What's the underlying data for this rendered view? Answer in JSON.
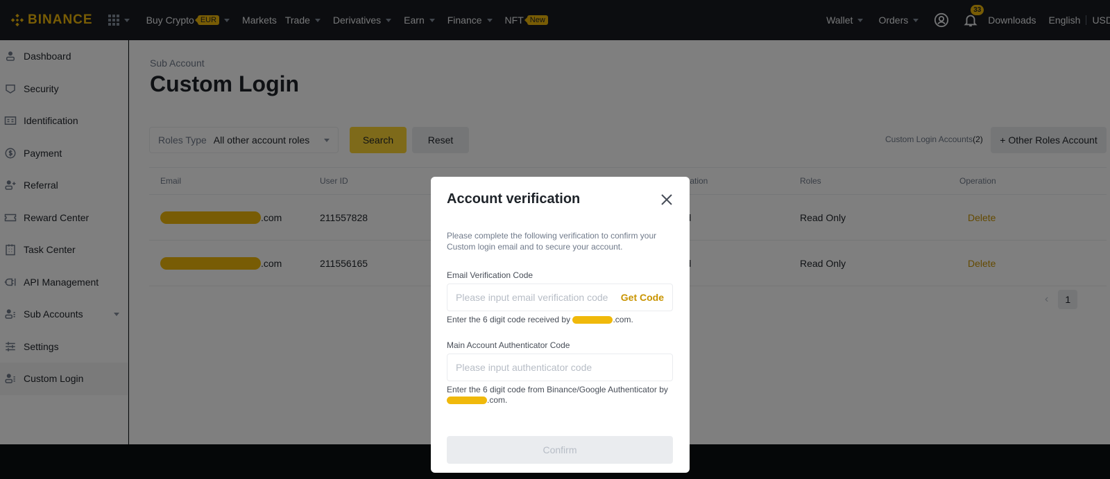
{
  "header": {
    "brand": "BINANCE",
    "nav": [
      {
        "label": "Buy Crypto",
        "badge": "EUR",
        "dropdown": true
      },
      {
        "label": "Markets",
        "dropdown": false
      },
      {
        "label": "Trade",
        "dropdown": true
      },
      {
        "label": "Derivatives",
        "dropdown": true
      },
      {
        "label": "Earn",
        "dropdown": true
      },
      {
        "label": "Finance",
        "dropdown": true
      },
      {
        "label": "NFT",
        "badge": "New",
        "dropdown": false
      }
    ],
    "right": {
      "wallet": "Wallet",
      "orders": "Orders",
      "notifications_count": "33",
      "downloads": "Downloads",
      "language": "English",
      "currency": "USD"
    }
  },
  "sidebar": {
    "items": [
      {
        "label": "Dashboard",
        "icon": "user-icon"
      },
      {
        "label": "Security",
        "icon": "shield-icon"
      },
      {
        "label": "Identification",
        "icon": "id-card-icon"
      },
      {
        "label": "Payment",
        "icon": "dollar-circle-icon"
      },
      {
        "label": "Referral",
        "icon": "user-plus-icon"
      },
      {
        "label": "Reward Center",
        "icon": "ticket-icon"
      },
      {
        "label": "Task Center",
        "icon": "clipboard-icon"
      },
      {
        "label": "API Management",
        "icon": "plug-icon"
      },
      {
        "label": "Sub Accounts",
        "icon": "user-list-icon",
        "dropdown": true
      },
      {
        "label": "Settings",
        "icon": "sliders-icon"
      },
      {
        "label": "Custom Login",
        "icon": "user-list-icon",
        "active": true
      }
    ]
  },
  "main": {
    "breadcrumb": "Sub Account",
    "title": "Custom Login",
    "filter": {
      "label": "Roles Type",
      "value": "All other account roles"
    },
    "search_label": "Search",
    "reset_label": "Reset",
    "accounts_count_label": "Custom Login Accounts",
    "accounts_count": "(2)",
    "other_roles_label": "+ Other Roles Account",
    "table": {
      "columns": [
        "Email",
        "User ID",
        "Verification",
        "Roles",
        "Operation"
      ],
      "columns_visible": {
        "verification": "erification"
      },
      "rows": [
        {
          "email_suffix": ".com",
          "user_id": "211557828",
          "verification": "eted",
          "roles": "Read Only",
          "operation": "Delete"
        },
        {
          "email_suffix": ".com",
          "user_id": "211556165",
          "verification": "eted",
          "roles": "Read Only",
          "operation": "Delete"
        }
      ]
    },
    "pagination": {
      "current_page": "1"
    }
  },
  "modal": {
    "title": "Account verification",
    "description": "Please complete the following verification to confirm your Custom login email and to secure your account.",
    "email_code": {
      "label": "Email Verification Code",
      "placeholder": "Please input email verification code",
      "value": "",
      "get_code_label": "Get Code",
      "hint_prefix": "Enter the 6 digit code received by ",
      "hint_suffix": ".com."
    },
    "auth_code": {
      "label": "Main Account Authenticator Code",
      "placeholder": "Please input authenticator code",
      "value": "",
      "hint_prefix": "Enter the 6 digit code from Binance/Google Authenticator by",
      "hint_suffix": ".com."
    },
    "confirm_label": "Confirm"
  },
  "colors": {
    "brand": "#f0b90b",
    "link": "#c99400",
    "header_bg": "#181a20"
  }
}
